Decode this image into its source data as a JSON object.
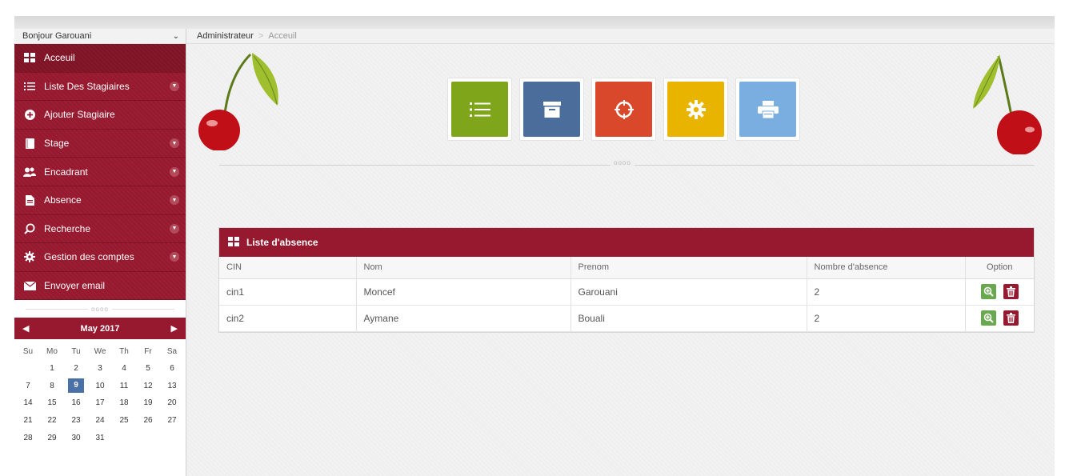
{
  "user_menu": {
    "greeting": "Bonjour Garouani"
  },
  "breadcrumb": {
    "root": "Administrateur",
    "separator": ">",
    "current": "Acceuil"
  },
  "sidebar": {
    "items": [
      {
        "label": "Acceuil",
        "icon": "dashboard-icon",
        "active": true,
        "has_submenu": false
      },
      {
        "label": "Liste Des Stagiaires",
        "icon": "list-icon",
        "has_submenu": true
      },
      {
        "label": "Ajouter Stagiaire",
        "icon": "plus-circle-icon",
        "has_submenu": false
      },
      {
        "label": "Stage",
        "icon": "book-icon",
        "has_submenu": true
      },
      {
        "label": "Encadrant",
        "icon": "users-icon",
        "has_submenu": true
      },
      {
        "label": "Absence",
        "icon": "document-icon",
        "has_submenu": true
      },
      {
        "label": "Recherche",
        "icon": "search-icon",
        "has_submenu": true
      },
      {
        "label": "Gestion des comptes",
        "icon": "gear-icon",
        "has_submenu": true
      },
      {
        "label": "Envoyer email",
        "icon": "envelope-icon",
        "has_submenu": false
      }
    ],
    "separator_dots": "oooo"
  },
  "calendar": {
    "month_label": "May 2017",
    "day_headers": [
      "Su",
      "Mo",
      "Tu",
      "We",
      "Th",
      "Fr",
      "Sa"
    ],
    "weeks": [
      [
        "",
        "1",
        "2",
        "3",
        "4",
        "5",
        "6"
      ],
      [
        "7",
        "8",
        "9",
        "10",
        "11",
        "12",
        "13"
      ],
      [
        "14",
        "15",
        "16",
        "17",
        "18",
        "19",
        "20"
      ],
      [
        "21",
        "22",
        "23",
        "24",
        "25",
        "26",
        "27"
      ],
      [
        "28",
        "29",
        "30",
        "31",
        "",
        "",
        ""
      ]
    ],
    "today": "9"
  },
  "shortcuts": [
    {
      "name": "list-shortcut",
      "icon": "list-icon",
      "color": "#7fa51a"
    },
    {
      "name": "archive-shortcut",
      "icon": "archive-icon",
      "color": "#4a6d9c"
    },
    {
      "name": "target-shortcut",
      "icon": "crosshair-icon",
      "color": "#d9482b"
    },
    {
      "name": "settings-shortcut",
      "icon": "gear-icon",
      "color": "#e8b400"
    },
    {
      "name": "print-shortcut",
      "icon": "printer-icon",
      "color": "#7aaee0"
    }
  ],
  "divider_dots": "oooo",
  "absence_panel": {
    "title": "Liste d'absence",
    "columns": [
      "CIN",
      "Nom",
      "Prenom",
      "Nombre d'absence",
      "Option"
    ],
    "rows": [
      {
        "cin": "cin1",
        "nom": "Moncef",
        "prenom": "Garouani",
        "nombre": "2"
      },
      {
        "cin": "cin2",
        "nom": "Aymane",
        "prenom": "Bouali",
        "nombre": "2"
      }
    ]
  },
  "colors": {
    "brand": "#97192f",
    "calendar_today": "#4a70a8"
  }
}
